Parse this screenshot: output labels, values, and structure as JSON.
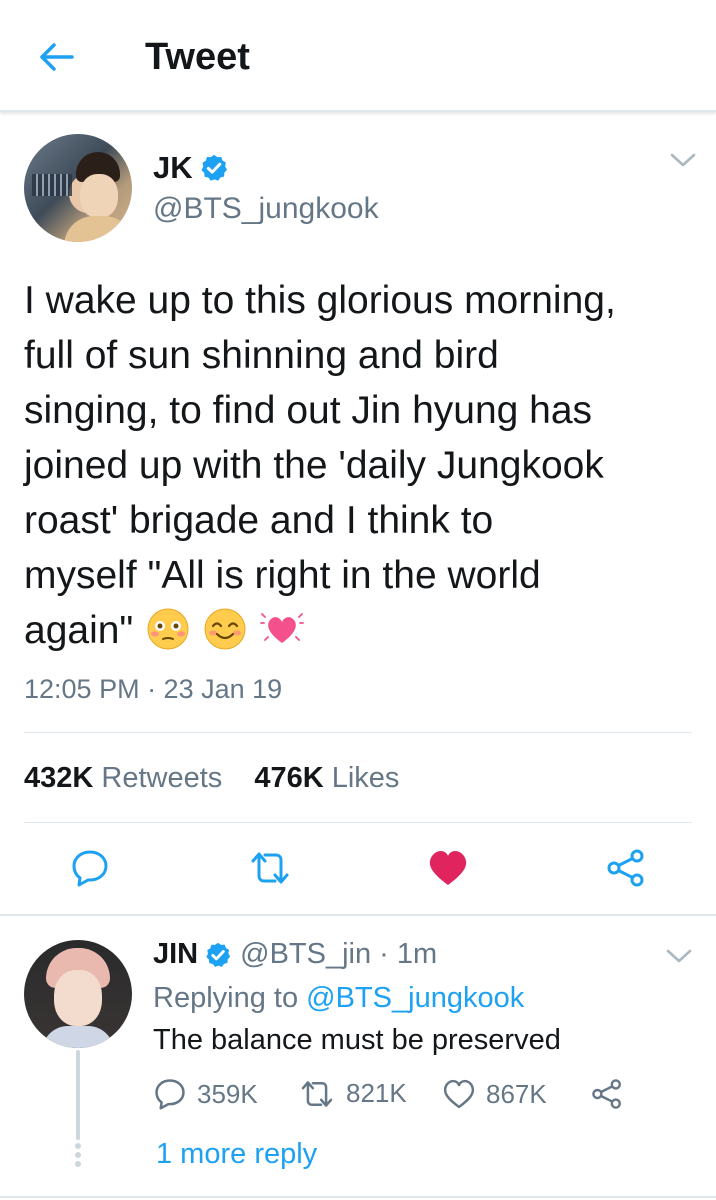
{
  "header": {
    "title": "Tweet",
    "back_icon": "back-arrow-icon"
  },
  "colors": {
    "accent": "#1da1f2",
    "like": "#e0245e",
    "secondary_text": "#657786",
    "verified": "#1da1f2"
  },
  "tweet": {
    "display_name": "JK",
    "handle": "@BTS_jungkook",
    "verified": true,
    "text_lines": [
      "I wake up to this glorious morning,",
      "full of sun shinning and bird",
      "singing, to find out Jin hyung has",
      "joined up with the 'daily Jungkook",
      "roast' brigade and I think to",
      "myself \"All is right in the world",
      "again\""
    ],
    "emojis": [
      "flushed-face-icon",
      "smiling-face-icon",
      "beating-heart-icon"
    ],
    "timestamp": "12:05 PM · 23 Jan 19",
    "retweets_count": "432K",
    "retweets_label": "Retweets",
    "likes_count": "476K",
    "likes_label": "Likes",
    "liked": true
  },
  "reply": {
    "display_name": "JIN",
    "verified": true,
    "meta": "@BTS_jin · 1m",
    "replying_prefix": "Replying to",
    "replying_to": "@BTS_jungkook",
    "text": "The balance must be preserved",
    "reply_count": "359K",
    "retweet_count": "821K",
    "like_count": "867K",
    "more_replies": "1 more reply"
  }
}
